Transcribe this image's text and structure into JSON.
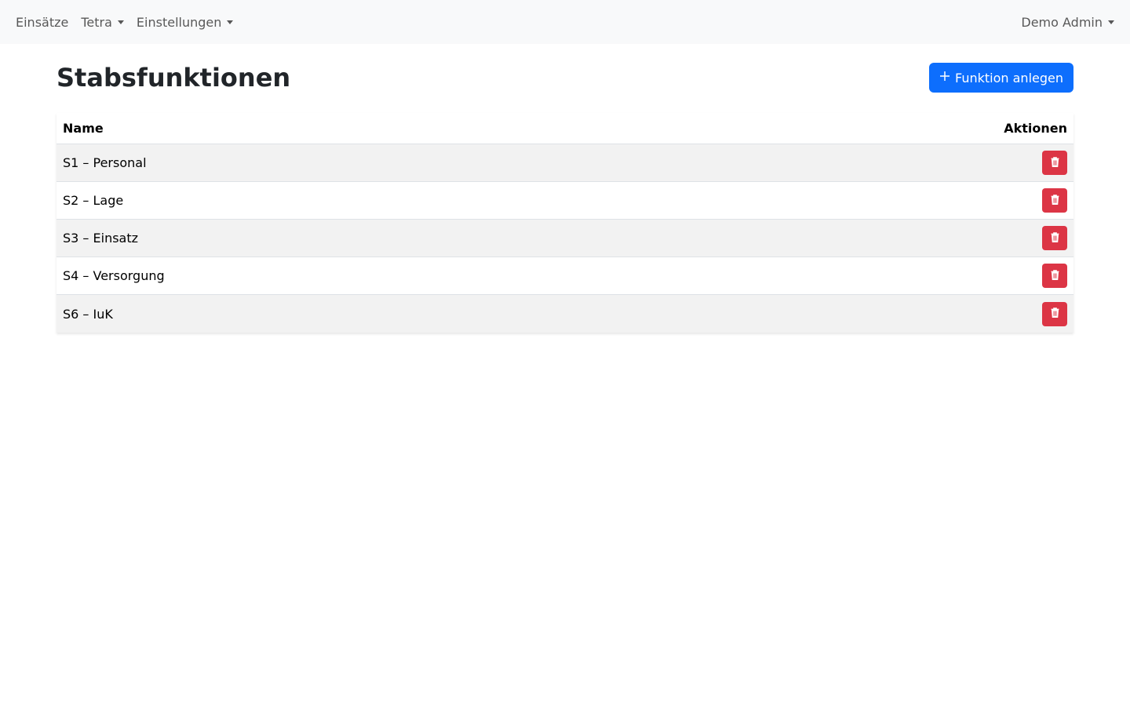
{
  "navbar": {
    "items": [
      {
        "label": "Einsätze",
        "dropdown": false
      },
      {
        "label": "Tetra",
        "dropdown": true
      },
      {
        "label": "Einstellungen",
        "dropdown": true
      }
    ],
    "user": {
      "label": "Demo Admin",
      "dropdown": true
    }
  },
  "page": {
    "title": "Stabsfunktionen",
    "add_button": {
      "icon": "plus-icon",
      "label": "Funktion anlegen"
    }
  },
  "table": {
    "headers": {
      "name": "Name",
      "actions": "Aktionen"
    },
    "rows": [
      {
        "name": "S1 – Personal"
      },
      {
        "name": "S2 – Lage"
      },
      {
        "name": "S3 – Einsatz"
      },
      {
        "name": "S4 – Versorgung"
      },
      {
        "name": "S6 – IuK"
      }
    ],
    "delete_icon": "trash-icon"
  },
  "colors": {
    "primary": "#0d6efd",
    "danger": "#dc3545",
    "navbar_bg": "#f8f9fa",
    "stripe": "#f2f2f2"
  }
}
